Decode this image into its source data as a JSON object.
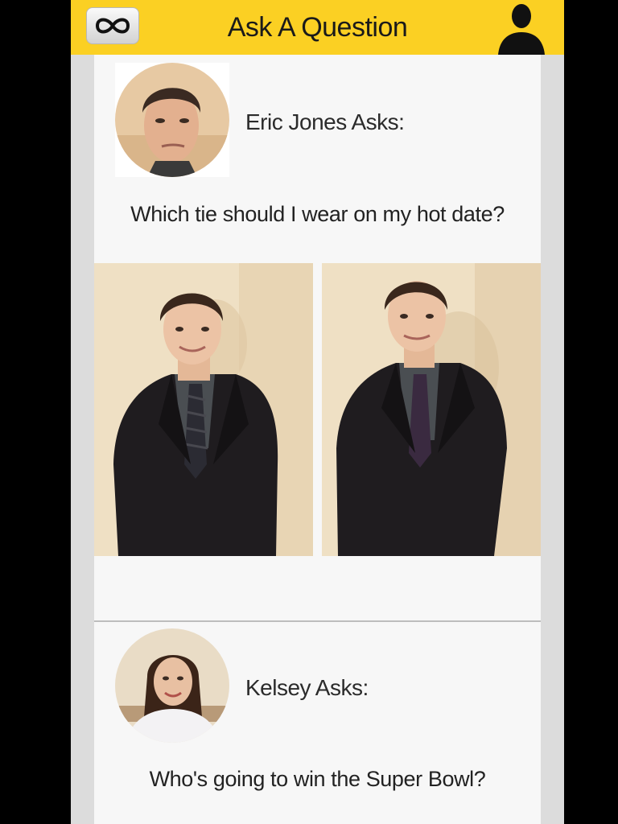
{
  "header": {
    "title": "Ask A Question",
    "menu_icon": "infinity-icon",
    "profile_icon": "user-silhouette-icon",
    "background": "#fbd023"
  },
  "feed": {
    "posts": [
      {
        "asker_label": "Eric Jones Asks:",
        "question": "Which tie should I wear on my hot date?",
        "avatar_icon": "avatar-photo",
        "options": [
          {
            "name": "option-photo-patterned-tie",
            "tie_color": "#2b2b33"
          },
          {
            "name": "option-photo-purple-tie",
            "tie_color": "#3a2a40"
          }
        ]
      },
      {
        "asker_label": "Kelsey Asks:",
        "question": "Who's going to win the Super Bowl?",
        "avatar_icon": "avatar-photo"
      }
    ]
  }
}
